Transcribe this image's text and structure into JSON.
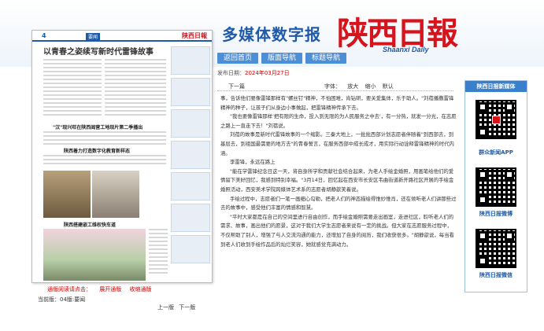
{
  "header": {
    "brand_title": "多媒体数字报",
    "logo": "陕西日報",
    "logo_sub": "Shaanxi Daily",
    "nav": [
      "返回首页",
      "版面导航",
      "标题导航"
    ]
  },
  "paper": {
    "page_no": "4",
    "section": "要闻",
    "masthead": "陕西日報",
    "headline": "以青春之姿续写新时代雷锋故事",
    "subheads": [
      "\"汉\"现兴旺在陕西阎营工地现片第二季播出",
      "陕西着力打造数字化教育新样态",
      "陕西搭建嵌工维权快车道"
    ]
  },
  "paper_links": [
    "通版阅读请点击：",
    "展开通版",
    "收缩通版"
  ],
  "current_page": {
    "label": "当前版：",
    "value": "04版:要闻"
  },
  "pager": [
    "上一版",
    "下一版"
  ],
  "article": {
    "date_label": "发布日期：",
    "date_value": "2024年03月27日",
    "next_label": "下一篇",
    "font_label": "字体：",
    "font_options": [
      "放大",
      "缩小",
      "默认"
    ],
    "paragraphs": [
      "事，告诉他们要像雷锋那样有\"螺丝钉\"精神，不怕困难，肯钻研，要关爱集体，乐于助人。\"刘蓓播撒雷锋精神的种子，让孩子们从身边小事做起，把雷锋精神传承下去。",
      "\"我也要像雷锋那样'把有限的生命，投入到无限的为人民服务之中去'，有一分热，就发一分光，在志愿之路上一直走下去！\"刘蓓说。",
      "刘蓓的故事是新时代雷锋故事的一个缩影。三秦大地上，一批批西部计划志愿者伴随着\"到西部去，到基层去，到祖国最需要的地方去\"的青春誓言，在服务西部中成长成才，用实际行动诠释雷锋精神的时代内涵。",
      "李雷锋，永远在路上",
      "\"能在学雷锋纪念日这一天，将自身所学和贡献社会结合起来，为老人手绘金婚照，用画笔给他们的爱情留下美好回忆，我感到特别幸福。\"3月14日，回忆起在西安市长安区韦曲街道新开路社区开展的手绘金婚照活动，西安美术学院跨媒体艺术系的志愿者胡静歆笑着说。",
      "手绘过程中，志愿者们一笔一画细心勾勒，把老人们的神态描绘得惟妙惟肖，还在倾听老人们讲那些过去的故事中，感受他们丰富的情感和智慧。",
      "\"平时大家都是在自己的空间里进行自由创作，而手绘金婚照需要走出画室，走进社区，聆听老人们的需求、故事，画出他们的愿景，这对于我们大学生志愿者来说有一定的挑战。但大家在志愿服务过程中，不仅帮助了别人，增强了与人交流沟通的能力，还增加了自身的阅历，我们收获很多。\"胡静歆说，每当看到老人们收到手绘作品后的灿烂笑容，她就感觉充满动力。"
    ]
  },
  "sidebar": {
    "title": "陕西日报新媒体",
    "items": [
      {
        "label": "群众新闻APP",
        "icon": "qr-code-icon"
      },
      {
        "label": "陕西日报微博",
        "icon": "qr-code-icon"
      },
      {
        "label": "陕西日报微信",
        "icon": "qr-code-icon"
      }
    ]
  },
  "colors": {
    "accent_blue": "#1f5aa8",
    "brand_red": "#d6141c",
    "nav_blue": "#4d8fd6"
  }
}
